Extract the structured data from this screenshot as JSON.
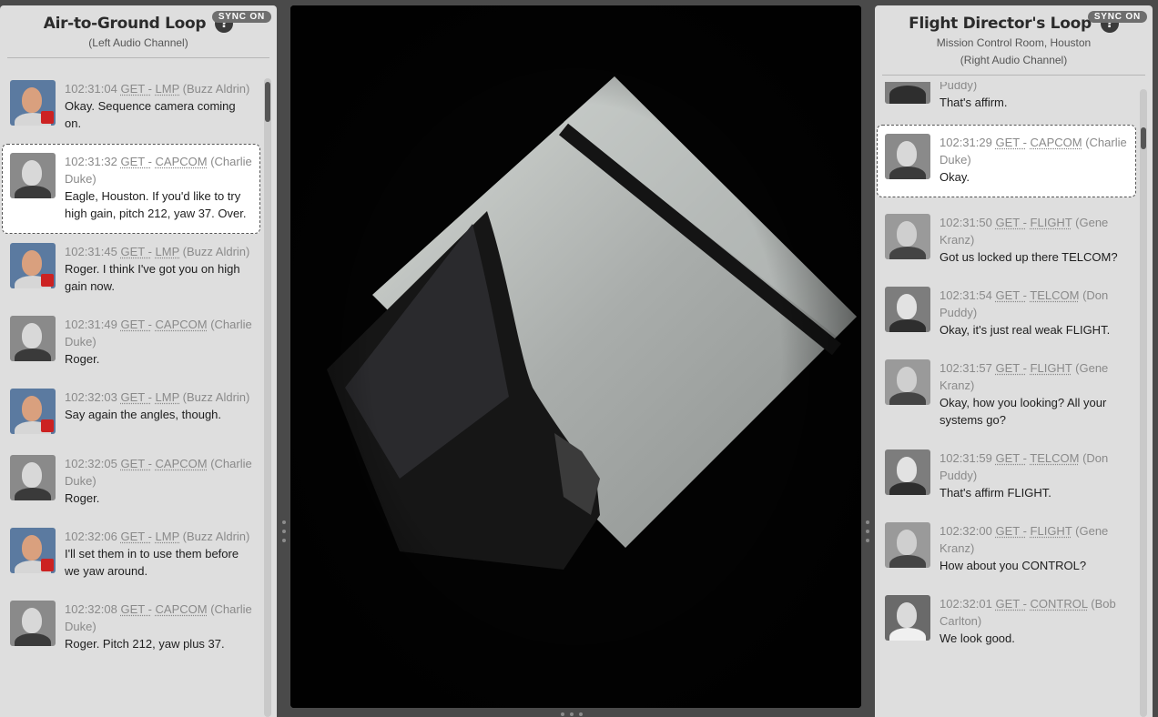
{
  "left": {
    "title": "Air-to-Ground Loop",
    "help": "?",
    "sync": "SYNC ON",
    "subtitle": "(Left Audio Channel)",
    "entries": [
      {
        "time": "102:31:04",
        "role": "LMP",
        "name": "(Buzz Aldrin)",
        "text": "Okay. Sequence camera coming on.",
        "avatar": "aldrin"
      },
      {
        "time": "102:31:32",
        "role": "CAPCOM",
        "name": "(Charlie Duke)",
        "text": "Eagle, Houston. If you'd like to try high gain, pitch 212, yaw 37. Over.",
        "avatar": "duke"
      },
      {
        "time": "102:31:45",
        "role": "LMP",
        "name": "(Buzz Aldrin)",
        "text": "Roger. I think I've got you on high gain now.",
        "avatar": "aldrin"
      },
      {
        "time": "102:31:49",
        "role": "CAPCOM",
        "name": "(Charlie Duke)",
        "text": "Roger.",
        "avatar": "duke"
      },
      {
        "time": "102:32:03",
        "role": "LMP",
        "name": "(Buzz Aldrin)",
        "text": "Say again the angles, though.",
        "avatar": "aldrin"
      },
      {
        "time": "102:32:05",
        "role": "CAPCOM",
        "name": "(Charlie Duke)",
        "text": "Roger.",
        "avatar": "duke"
      },
      {
        "time": "102:32:06",
        "role": "LMP",
        "name": "(Buzz Aldrin)",
        "text": "I'll set them in to use them before we yaw around.",
        "avatar": "aldrin"
      },
      {
        "time": "102:32:08",
        "role": "CAPCOM",
        "name": "(Charlie Duke)",
        "text": "Roger. Pitch 212, yaw plus 37.",
        "avatar": "duke"
      }
    ]
  },
  "right": {
    "title": "Flight Director's Loop",
    "help": "?",
    "sync": "SYNC ON",
    "subtitle1": "Mission Control Room, Houston",
    "subtitle2": "(Right Audio Channel)",
    "partial_name": "Puddy)",
    "partial_text": "That's affirm.",
    "entries": [
      {
        "time": "102:31:29",
        "role": "CAPCOM",
        "name": "(Charlie Duke)",
        "text": "Okay.",
        "avatar": "duke"
      },
      {
        "time": "102:31:50",
        "role": "FLIGHT",
        "name": "(Gene Kranz)",
        "text": "Got us locked up there TELCOM?",
        "avatar": "kranz"
      },
      {
        "time": "102:31:54",
        "role": "TELCOM",
        "name": "(Don Puddy)",
        "text": "Okay, it's just real weak FLIGHT.",
        "avatar": "puddy"
      },
      {
        "time": "102:31:57",
        "role": "FLIGHT",
        "name": "(Gene Kranz)",
        "text": "Okay, how you looking? All your systems go?",
        "avatar": "kranz"
      },
      {
        "time": "102:31:59",
        "role": "TELCOM",
        "name": "(Don Puddy)",
        "text": "That's affirm FLIGHT.",
        "avatar": "puddy"
      },
      {
        "time": "102:32:00",
        "role": "FLIGHT",
        "name": "(Gene Kranz)",
        "text": "How about you CONTROL?",
        "avatar": "kranz"
      },
      {
        "time": "102:32:01",
        "role": "CONTROL",
        "name": "(Bob Carlton)",
        "text": "We look good.",
        "avatar": "carlton"
      }
    ]
  },
  "sep": "GET -"
}
